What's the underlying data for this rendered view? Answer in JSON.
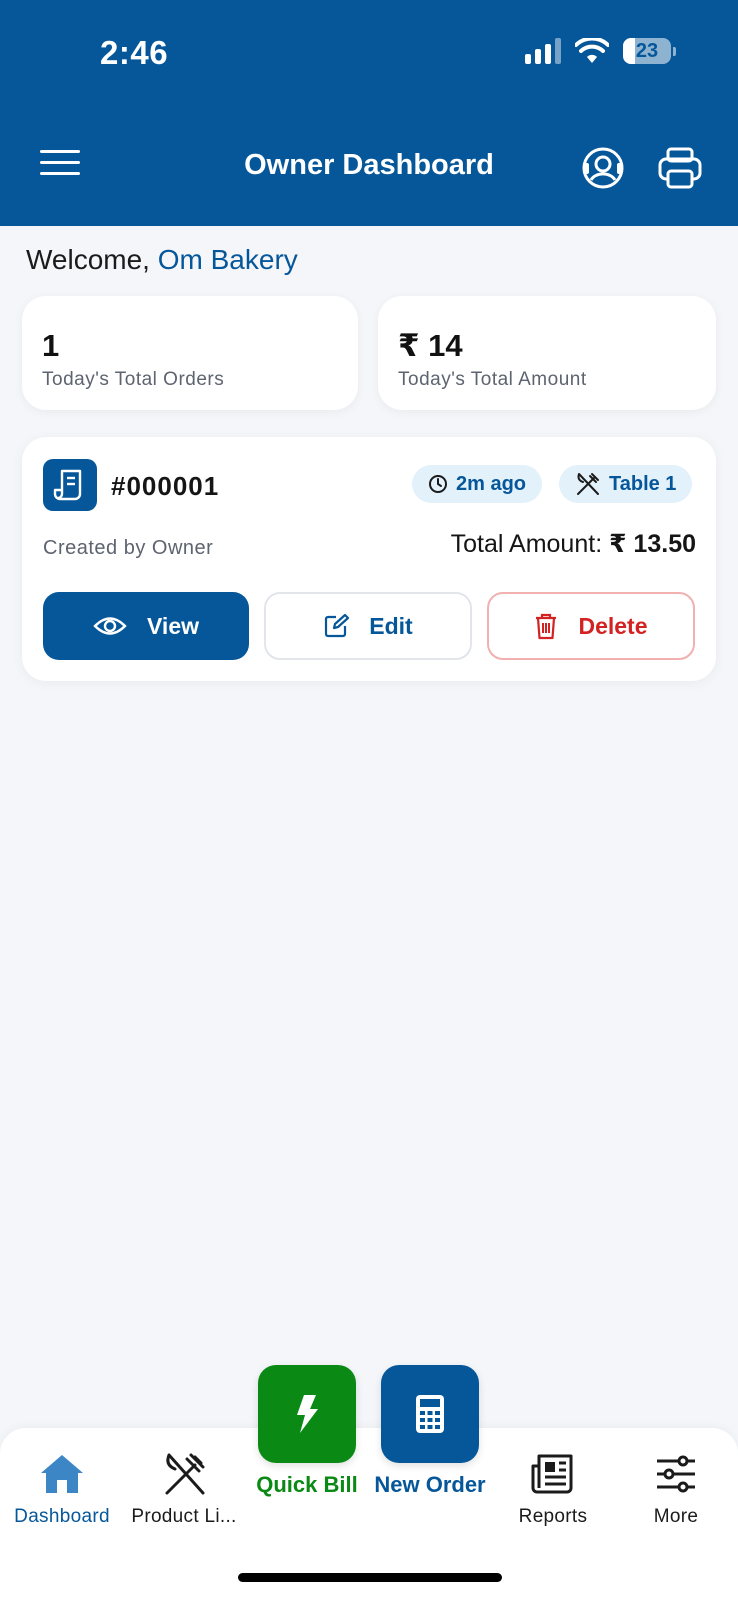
{
  "status_bar": {
    "time": "2:46",
    "battery": "23"
  },
  "header": {
    "title": "Owner Dashboard"
  },
  "welcome": {
    "prefix": "Welcome,",
    "store_name": "Om Bakery"
  },
  "stats": [
    {
      "value": "1",
      "label": "Today's Total Orders"
    },
    {
      "value": "₹ 14",
      "label": "Today's Total Amount"
    }
  ],
  "order": {
    "id": "#000001",
    "time_ago": "2m ago",
    "table": "Table 1",
    "created_by": "Created by Owner",
    "total_label": "Total Amount:",
    "total_value": "₹ 13.50",
    "actions": {
      "view": "View",
      "edit": "Edit",
      "delete": "Delete"
    }
  },
  "fab": {
    "quick_bill": "Quick Bill",
    "new_order": "New Order"
  },
  "bottom_nav": [
    {
      "label": "Dashboard",
      "icon": "home-icon",
      "active": true
    },
    {
      "label": "Product Li...",
      "icon": "fork-knife-icon"
    },
    {
      "label": "Reports",
      "icon": "newspaper-icon"
    },
    {
      "label": "More",
      "icon": "sliders-icon"
    }
  ],
  "colors": {
    "primary": "#06579a",
    "quick_bill": "#0a8a14",
    "delete": "#d32222",
    "background": "#f4f6fa"
  }
}
